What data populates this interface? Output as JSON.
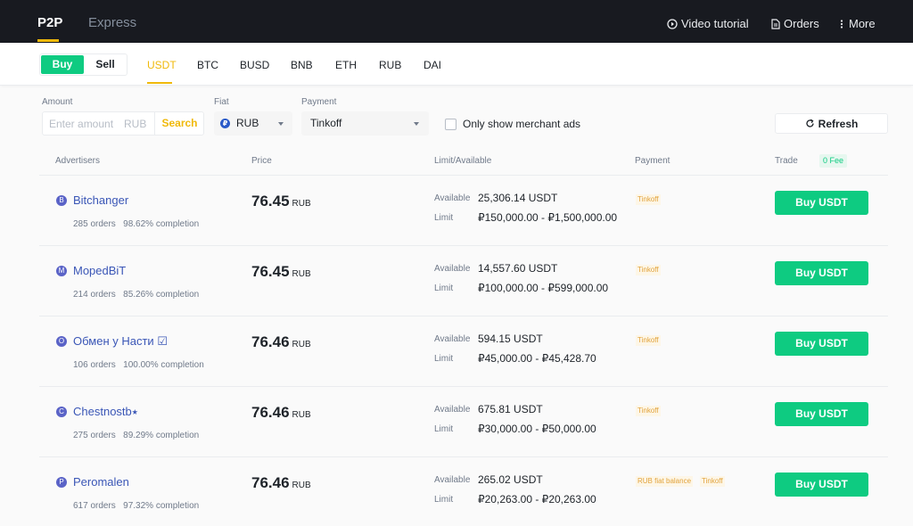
{
  "topnav": {
    "tabs": [
      "P2P",
      "Express"
    ],
    "video_tutorial": "Video tutorial",
    "orders": "Orders",
    "more": "More"
  },
  "trade_toggle": {
    "buy": "Buy",
    "sell": "Sell"
  },
  "assets": [
    "USDT",
    "BTC",
    "BUSD",
    "BNB",
    "ETH",
    "RUB",
    "DAI"
  ],
  "active_asset": "USDT",
  "filters": {
    "amount_label": "Amount",
    "amount_placeholder": "Enter amount",
    "amount_currency": "RUB",
    "search": "Search",
    "fiat_label": "Fiat",
    "fiat_value": "RUB",
    "fiat_icon_letter": "₽",
    "payment_label": "Payment",
    "payment_value": "Tinkoff",
    "merchant_only": "Only show merchant ads",
    "refresh": "Refresh"
  },
  "table": {
    "headers": {
      "advertisers": "Advertisers",
      "price": "Price",
      "limit": "Limit/Available",
      "payment": "Payment",
      "trade": "Trade",
      "fee": "0 Fee"
    },
    "available_label": "Available",
    "limit_label": "Limit",
    "rows": [
      {
        "initial": "B",
        "name": "Bitchanger",
        "orders": "285 orders",
        "completion": "98.62% completion",
        "price": "76.45",
        "price_unit": "RUB",
        "available": "25,306.14 USDT",
        "limit": "₽150,000.00 - ₽1,500,000.00",
        "payments": [
          "Tinkoff"
        ],
        "button": "Buy USDT"
      },
      {
        "initial": "M",
        "name": "MopedBiT",
        "orders": "214 orders",
        "completion": "85.26% completion",
        "price": "76.45",
        "price_unit": "RUB",
        "available": "14,557.60 USDT",
        "limit": "₽100,000.00 - ₽599,000.00",
        "payments": [
          "Tinkoff"
        ],
        "button": "Buy USDT"
      },
      {
        "initial": "О",
        "name": "Обмен у Насти ☑",
        "orders": "106 orders",
        "completion": "100.00% completion",
        "price": "76.46",
        "price_unit": "RUB",
        "available": "594.15 USDT",
        "limit": "₽45,000.00 - ₽45,428.70",
        "payments": [
          "Tinkoff"
        ],
        "button": "Buy USDT"
      },
      {
        "initial": "C",
        "name": "Chestnostb⭑",
        "orders": "275 orders",
        "completion": "89.29% completion",
        "price": "76.46",
        "price_unit": "RUB",
        "available": "675.81 USDT",
        "limit": "₽30,000.00 - ₽50,000.00",
        "payments": [
          "Tinkoff"
        ],
        "button": "Buy USDT"
      },
      {
        "initial": "P",
        "name": "Peromalen",
        "orders": "617 orders",
        "completion": "97.32% completion",
        "price": "76.46",
        "price_unit": "RUB",
        "available": "265.02 USDT",
        "limit": "₽20,263.00 - ₽20,263.00",
        "payments": [
          "RUB fiat balance",
          "Tinkoff"
        ],
        "button": "Buy USDT"
      }
    ]
  },
  "colors": {
    "nav_bg": "#181a20",
    "accent": "#f0b90b",
    "buy_green": "#0ecb81",
    "link_blue": "#3a56b6",
    "payment_tag": "#e2a33c"
  }
}
